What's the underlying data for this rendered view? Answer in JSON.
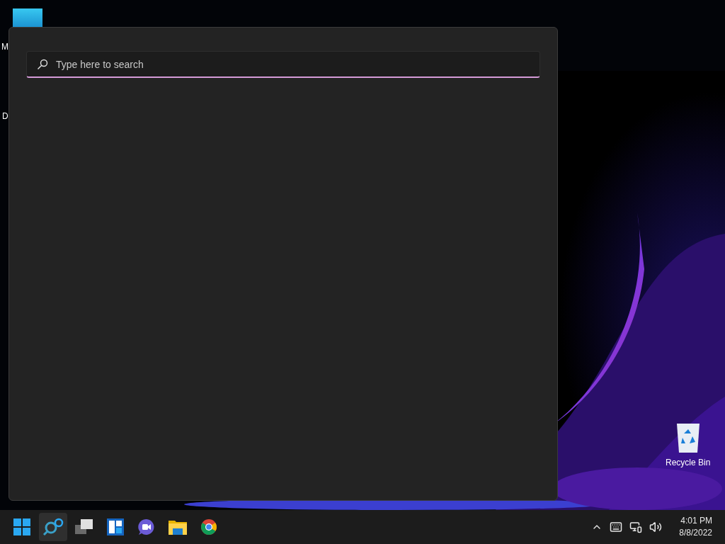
{
  "desktop": {
    "icons": [
      {
        "kind": "app",
        "label": "M"
      },
      {
        "kind": "app",
        "label": "D"
      },
      {
        "kind": "recycle",
        "label": "Recycle Bin"
      }
    ]
  },
  "search_panel": {
    "search": {
      "placeholder": "Type here to search"
    }
  },
  "taskbar": {
    "apps": [
      {
        "kind": "start",
        "selected": false
      },
      {
        "kind": "search",
        "selected": true
      },
      {
        "kind": "taskview",
        "selected": false
      },
      {
        "kind": "widgets",
        "selected": false
      },
      {
        "kind": "chat",
        "selected": false
      },
      {
        "kind": "explorer",
        "selected": false
      },
      {
        "kind": "browser",
        "selected": false
      }
    ],
    "tray": {
      "time": "4:01 PM",
      "date": "8/8/2022"
    }
  }
}
